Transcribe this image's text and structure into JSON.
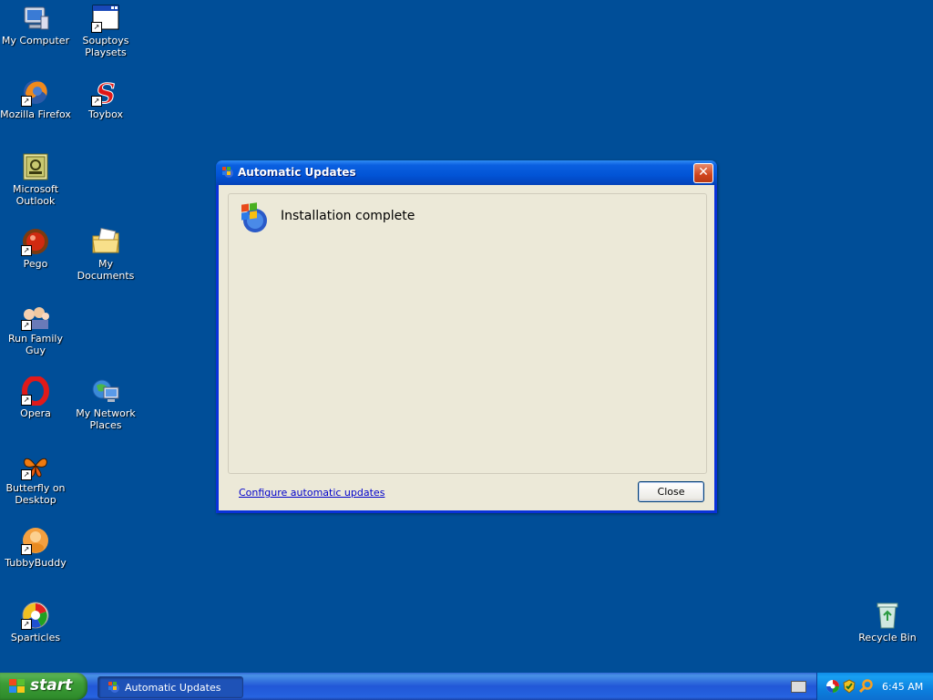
{
  "desktop": {
    "icons": [
      {
        "label": "My Computer"
      },
      {
        "label": "Souptoys Playsets"
      },
      {
        "label": "Mozilla Firefox"
      },
      {
        "label": "Toybox"
      },
      {
        "label": "Microsoft Outlook"
      },
      {
        "label": "Pego"
      },
      {
        "label": "My Documents"
      },
      {
        "label": "Run Family Guy"
      },
      {
        "label": "Opera"
      },
      {
        "label": "My Network Places"
      },
      {
        "label": "Butterfly on Desktop"
      },
      {
        "label": "TubbyBuddy"
      },
      {
        "label": "Sparticles"
      },
      {
        "label": "Recycle Bin"
      }
    ]
  },
  "dialog": {
    "title": "Automatic Updates",
    "heading": "Installation complete",
    "link": "Configure automatic updates",
    "close_button": "Close",
    "close_glyph": "✕"
  },
  "taskbar": {
    "start_label": "start",
    "window_button": "Automatic Updates",
    "clock": "6:45 AM"
  },
  "colors": {
    "desktop": "#004e98",
    "titlebar": "#0254d6",
    "start": "#3c9c36"
  }
}
